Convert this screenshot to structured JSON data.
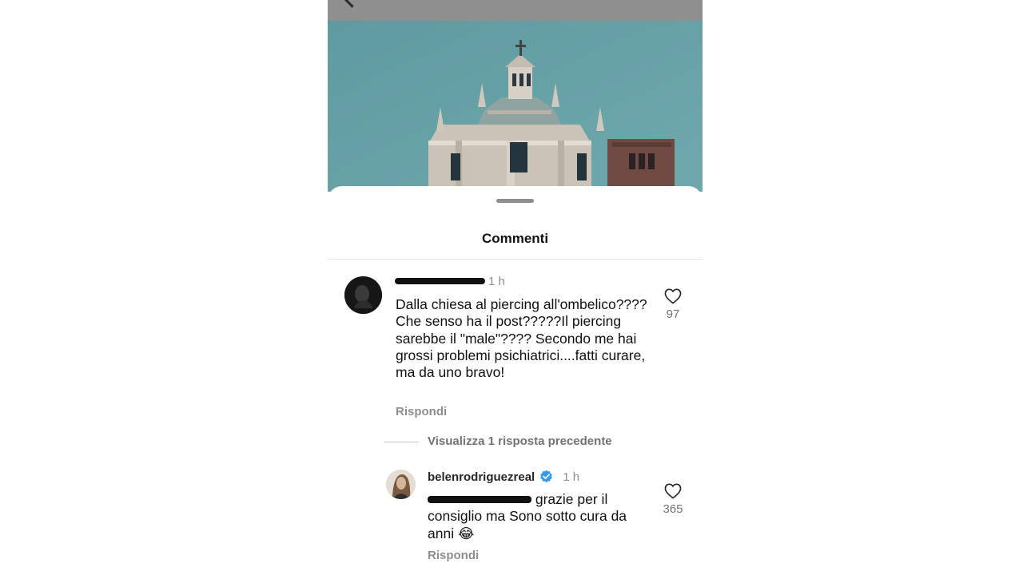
{
  "sheet": {
    "title": "Commenti"
  },
  "comments": [
    {
      "time": "1 h",
      "text": "Dalla chiesa al piercing all'ombelico????Che senso ha il post?????Il piercing sarebbe il \"male\"???? Secondo me hai grossi problemi psichiatrici....fatti curare, ma da uno bravo!",
      "reply_label": "Rispondi",
      "likes": "97"
    }
  ],
  "view_replies": "Visualizza 1 risposta precedente",
  "reply": {
    "username": "belenrodriguezreal",
    "time": "1 h",
    "text": "grazie per il consiglio ma Sono sotto cura da anni",
    "emoji": "😂",
    "reply_label": "Rispondi",
    "likes": "365"
  },
  "icons": {
    "back": "chevron-left-icon",
    "like": "heart-outline-icon",
    "verified": "verified-badge-icon"
  },
  "colors": {
    "verified_blue": "#3897f0",
    "muted_text": "#8e8e8e"
  }
}
